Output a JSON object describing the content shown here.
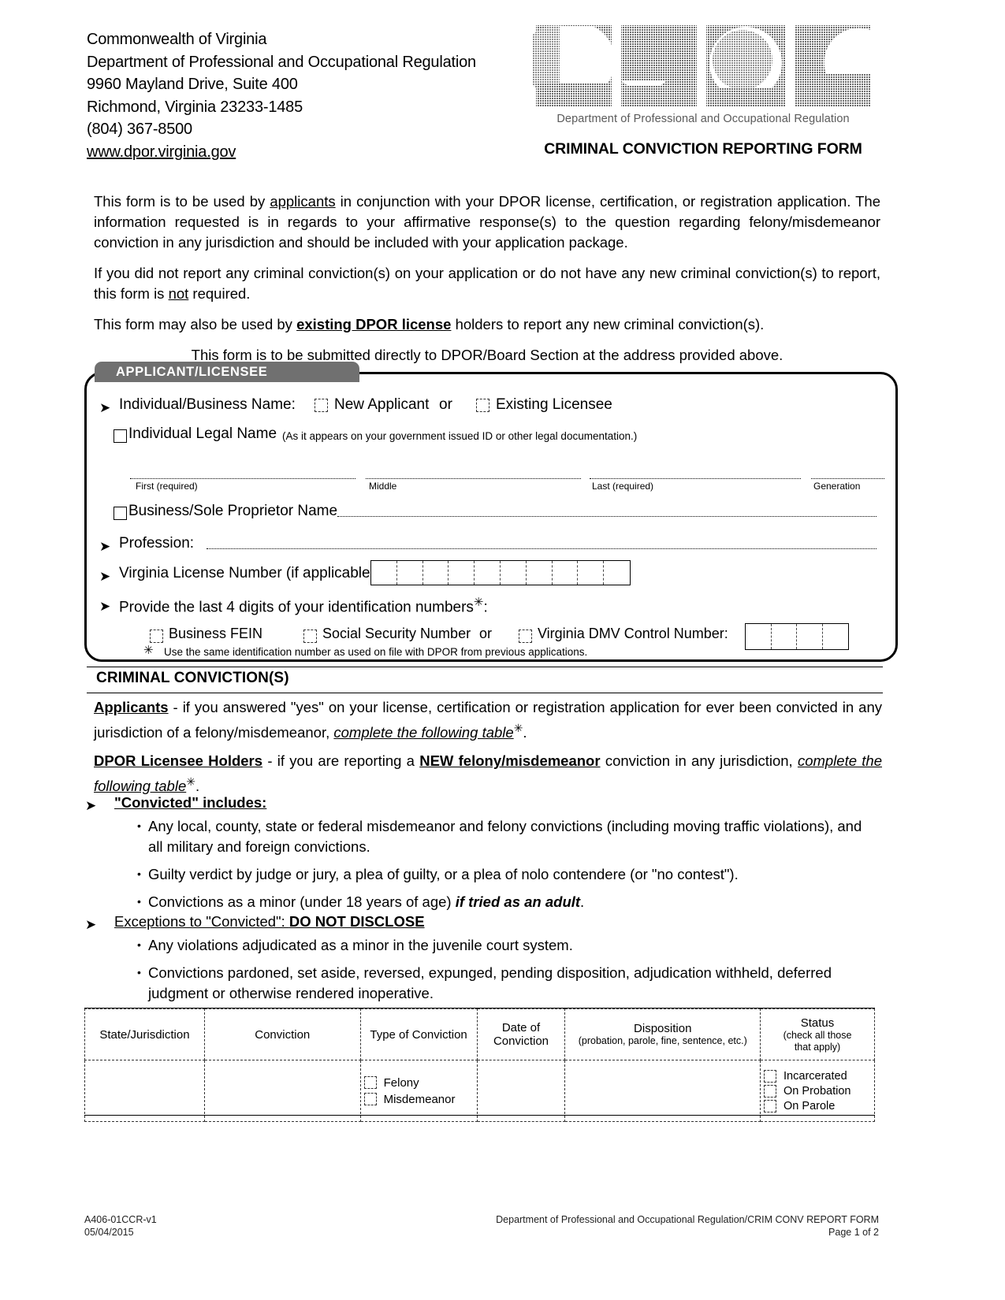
{
  "header": {
    "address_lines": [
      "Commonwealth of Virginia",
      "Department of Professional and Occupational Regulation",
      "9960 Mayland Drive, Suite 400",
      "Richmond, Virginia 23233-1485",
      "(804) 367-8500"
    ],
    "website": "www.dpor.virginia.gov",
    "logo_text": "DPOR",
    "logo_subtitle": "Department of Professional and Occupational Regulation",
    "form_title": "CRIMINAL CONVICTION REPORTING FORM"
  },
  "intro": {
    "p1_a": "This form is to be used by ",
    "p1_b": "applicants",
    "p1_c": " in conjunction with your DPOR license, certification, or registration application.  The information requested is in regards to your affirmative response(s) to the question regarding felony/misdemeanor conviction in any jurisdiction and should be included with your application package.",
    "p2_a": "If you did not report any criminal conviction(s) on your application or do not have any new criminal conviction(s) to report, this form is ",
    "p2_b": "not",
    "p2_c": " required.",
    "p3_a": "This form may also be used by ",
    "p3_b": "existing DPOR license",
    "p3_c": " holders to report any new criminal conviction(s).",
    "p4": "This form is to be submitted directly to DPOR/Board Section at the address provided above."
  },
  "applicant": {
    "tab_label": "APPLICANT/LICENSEE",
    "name_row_label": "Individual/Business Name:",
    "new_applicant_label": "New Applicant",
    "or_label": "or",
    "existing_licensee_label": "Existing Licensee",
    "individual_legal_name_label": "Individual Legal Name",
    "individual_legal_name_note": "(As it appears on your government issued ID or other legal documentation.)",
    "first_label": "First  (required)",
    "middle_label": "Middle",
    "last_label": "Last  (required)",
    "generation_label": "Generation",
    "business_name_label": "Business/Sole Proprietor Name",
    "profession_label": "Profession:",
    "license_number_label": "Virginia License Number (if applicable)",
    "license_number_cells": 10,
    "identification_label": "Provide the last 4 digits of your identification numbers",
    "identification_asterisk": "✳",
    "identification_colon": ":",
    "business_fein_label": "Business FEIN",
    "ssn_label": "Social Security Number",
    "or_label2": "or",
    "dmv_label": "Virginia DMV Control Number:",
    "id_cells": 4,
    "footnote_mark": "✳",
    "footnote": "Use the same identification number as used on file with DPOR from previous applications."
  },
  "convictions": {
    "section_title": "CRIMINAL CONVICTION(S)",
    "applicants_bold": "Applicants",
    "applicants_rest": " - if you answered \"yes\" on your license, certification or registration application for ever been convicted in any jurisdiction of a felony/misdemeanor, ",
    "applicants_italic": "complete the following table",
    "applicants_dot": ".",
    "holders_bold": "DPOR Licensee Holders",
    "holders_mid1": " - if you are reporting a ",
    "holders_new": "NEW felony/misdemeanor",
    "holders_mid2": " conviction in any jurisdiction, ",
    "holders_italic": "complete the following table",
    "holders_dot": ".",
    "asterisk": "✳",
    "convicted_head": "\"Convicted\" includes:",
    "convicted_items": [
      "Any local, county, state or federal misdemeanor and felony convictions (including moving traffic violations), and all military and foreign convictions.",
      "Guilty verdict by judge or jury, a plea of guilty, or a plea of nolo contendere (or \"no contest\").",
      "Convictions as a minor (under 18 years of age) if tried as an adult."
    ],
    "exceptions_head_a": "Exceptions to \"Convicted\": ",
    "exceptions_head_b": "DO NOT DISCLOSE",
    "exceptions_items": [
      "Any violations adjudicated as a minor in the juvenile court system.",
      "Convictions pardoned, set aside, reversed, expunged, pending disposition, adjudication withheld, deferred judgment or otherwise rendered inoperative."
    ]
  },
  "table": {
    "columns": [
      {
        "main": "State/Jurisdiction",
        "sub": ""
      },
      {
        "main": "Conviction",
        "sub": ""
      },
      {
        "main": "Type of Conviction",
        "sub": ""
      },
      {
        "main": "Date of",
        "sub": "Conviction"
      },
      {
        "main": "Disposition",
        "sub": "(probation, parole, fine, sentence, etc.)"
      },
      {
        "main": "Status",
        "sub": "(check all those\nthat apply)"
      }
    ],
    "type_options": [
      "Felony",
      "Misdemeanor"
    ],
    "status_options": [
      "Incarcerated",
      "On Probation",
      "On Parole"
    ],
    "row_values": [
      "",
      "",
      "",
      "",
      ""
    ]
  },
  "footer": {
    "form_code": "A406-01CCR-v1",
    "form_date": "05/04/2015",
    "dept_line": "Department of Professional and Occupational Regulation/CRIM CONV REPORT FORM",
    "page_line": "Page 1 of 2"
  },
  "colors": {
    "tab_bg": "#707070",
    "logo_gray": "#8a8a8a",
    "text": "#000000"
  }
}
